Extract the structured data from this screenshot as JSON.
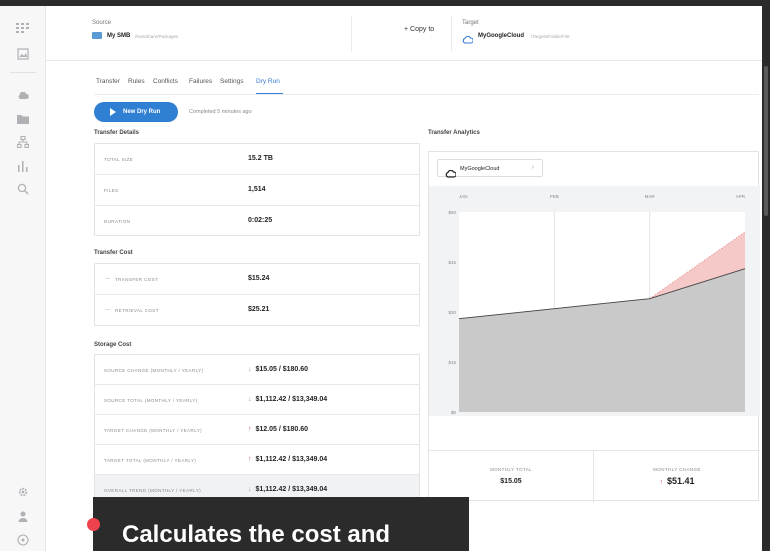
{
  "header": {
    "source_label": "Source",
    "source_name": "My SMB",
    "source_path": "/NewShare/Packages",
    "copy_to_label": "Copy to",
    "target_label": "Target",
    "target_name": "MyGoogleCloud",
    "target_path": "/Targets/Folder/File"
  },
  "tabs": [
    "Transfer",
    "Rules",
    "Conflicts",
    "Failures",
    "Settings",
    "Dry Run"
  ],
  "active_tab": "Dry Run",
  "run": {
    "button_label": "New Dry Run",
    "completed_text": "Completed 5 minutes ago"
  },
  "transfer_details": {
    "title": "Transfer Details",
    "rows": [
      {
        "label": "TOTAL SIZE",
        "value": "15.2 TB"
      },
      {
        "label": "FILES",
        "value": "1,514"
      },
      {
        "label": "DURATION",
        "value": "0:02:25"
      }
    ]
  },
  "transfer_cost": {
    "title": "Transfer Cost",
    "rows": [
      {
        "label": "TRANSFER COST",
        "value": "$15.24"
      },
      {
        "label": "RETRIEVAL COST",
        "value": "$25.21"
      }
    ]
  },
  "storage_cost": {
    "title": "Storage Cost",
    "rows": [
      {
        "label": "SOURCE CHANGE (MONTHLY / YEARLY)",
        "value": "$15.05 / $180.60",
        "trend": "down"
      },
      {
        "label": "SOURCE TOTAL (MONTHLY / YEARLY)",
        "value": "$1,112.42 / $13,349.04",
        "trend": "down"
      },
      {
        "label": "TARGET CHANGE (MONTHLY / YEARLY)",
        "value": "$12.05 / $180.60",
        "trend": "up"
      },
      {
        "label": "TARGET TOTAL (MONTHLY / YEARLY)",
        "value": "$1,112.42 / $13,349.04",
        "trend": "up"
      },
      {
        "label": "OVERALL TREND (MONTHLY / YEARLY)",
        "value": "$1,112.42 / $13,349.04",
        "trend": "down"
      }
    ]
  },
  "analytics": {
    "title": "Transfer Analytics",
    "selected_target": "MyGoogleCloud",
    "monthly_total_label": "MONTHLY TOTAL",
    "monthly_total_value": "$15.05",
    "monthly_change_label": "MONTHLY CHANGE",
    "monthly_change_value": "$51.41"
  },
  "chart_data": {
    "type": "area",
    "categories": [
      "JAN",
      "FEB",
      "MAR",
      "APR"
    ],
    "yticks": [
      "$60",
      "$45",
      "$30",
      "$15",
      "$0"
    ],
    "ylim": [
      0,
      60
    ],
    "series": [
      {
        "values": [
          28,
          31,
          34,
          43
        ],
        "color": "#c9c9c9"
      },
      {
        "values": [
          28,
          31,
          34,
          54
        ],
        "color": "#f5c0c0"
      }
    ]
  },
  "caption": {
    "text": "Calculates the cost and"
  },
  "colors": {
    "accent": "#2f7fd3",
    "up": "#e05757",
    "down": "#9aa0a6"
  }
}
